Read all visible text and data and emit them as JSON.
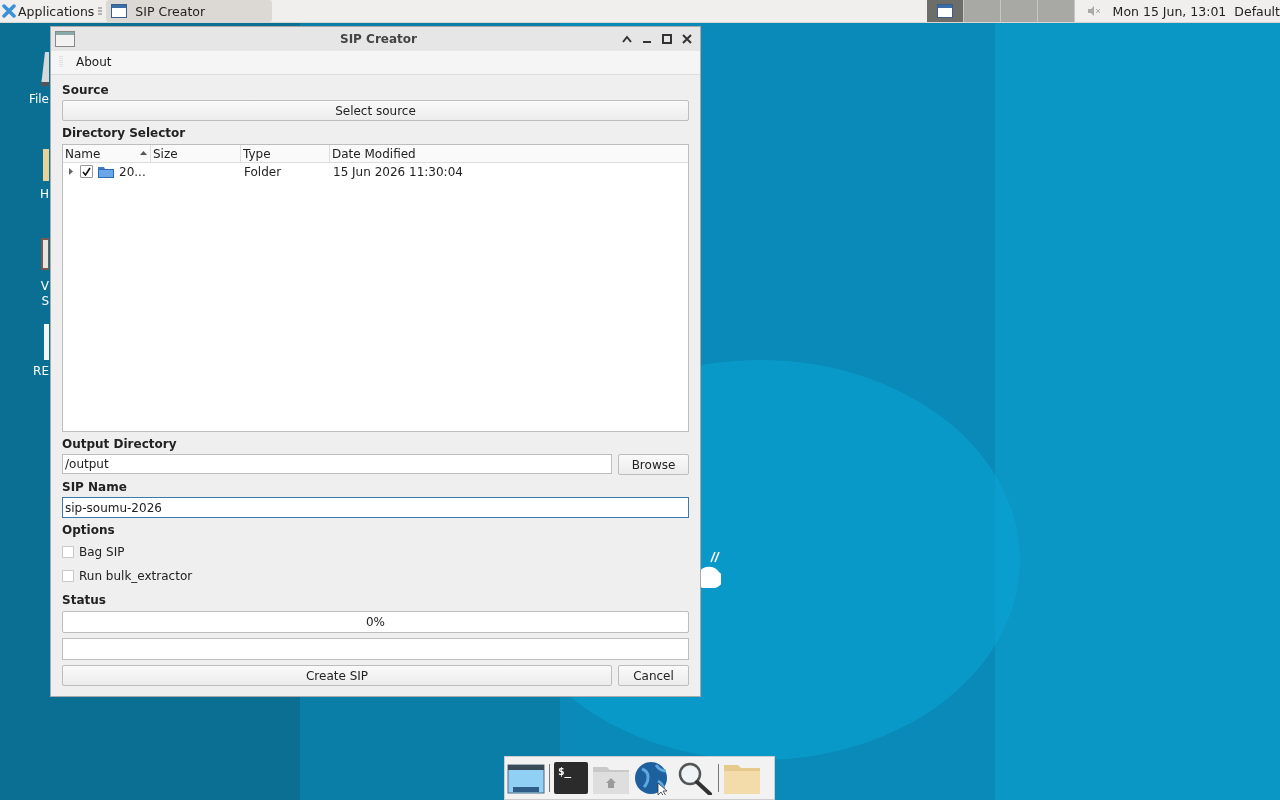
{
  "top_panel": {
    "applications": "Applications",
    "tasks": [
      {
        "title": "SIP Creator",
        "selected": true
      }
    ],
    "workspaces": [
      {
        "selected": true
      },
      {
        "selected": false
      },
      {
        "selected": false
      },
      {
        "selected": false
      }
    ],
    "clock": "Mon 15 Jun, 13:01",
    "user": "Default"
  },
  "desktop_icons": [
    {
      "kind": "drive",
      "label": "File"
    },
    {
      "kind": "folder",
      "label": "H"
    },
    {
      "kind": "box",
      "label": "V\nS"
    },
    {
      "kind": "doc",
      "label": "RE"
    }
  ],
  "window": {
    "title": "SIP Creator",
    "menu": [
      "About"
    ],
    "source": {
      "label": "Source",
      "button": "Select source"
    },
    "directory_selector": {
      "label": "Directory Selector",
      "columns": [
        {
          "title": "Name",
          "sorted": true
        },
        {
          "title": "Size",
          "sorted": false
        },
        {
          "title": "Type",
          "sorted": false
        },
        {
          "title": "Date Modified",
          "sorted": false
        }
      ],
      "rows": [
        {
          "expanded": false,
          "checked": true,
          "name": "20...",
          "size": "",
          "type": "Folder",
          "date": "15 Jun 2026 11:30:04"
        }
      ]
    },
    "output_directory": {
      "label": "Output Directory",
      "value": "/output",
      "button": "Browse"
    },
    "sip_name": {
      "label": "SIP Name",
      "value": "sip-soumu-2026",
      "focused": true
    },
    "options": {
      "label": "Options",
      "items": [
        {
          "label": "Bag SIP",
          "checked": false
        },
        {
          "label": "Run bulk_extractor",
          "checked": false
        }
      ]
    },
    "status": {
      "label": "Status",
      "progress": {
        "level": 0,
        "text": "0%"
      }
    },
    "buttons": [
      "Create SIP",
      "Cancel"
    ]
  },
  "dock": [
    {
      "kind": "desktop"
    },
    {
      "kind": "terminal",
      "glyph": "$_"
    },
    {
      "kind": "home"
    },
    {
      "kind": "globe"
    },
    {
      "kind": "search"
    },
    {
      "kind": "folder"
    }
  ]
}
